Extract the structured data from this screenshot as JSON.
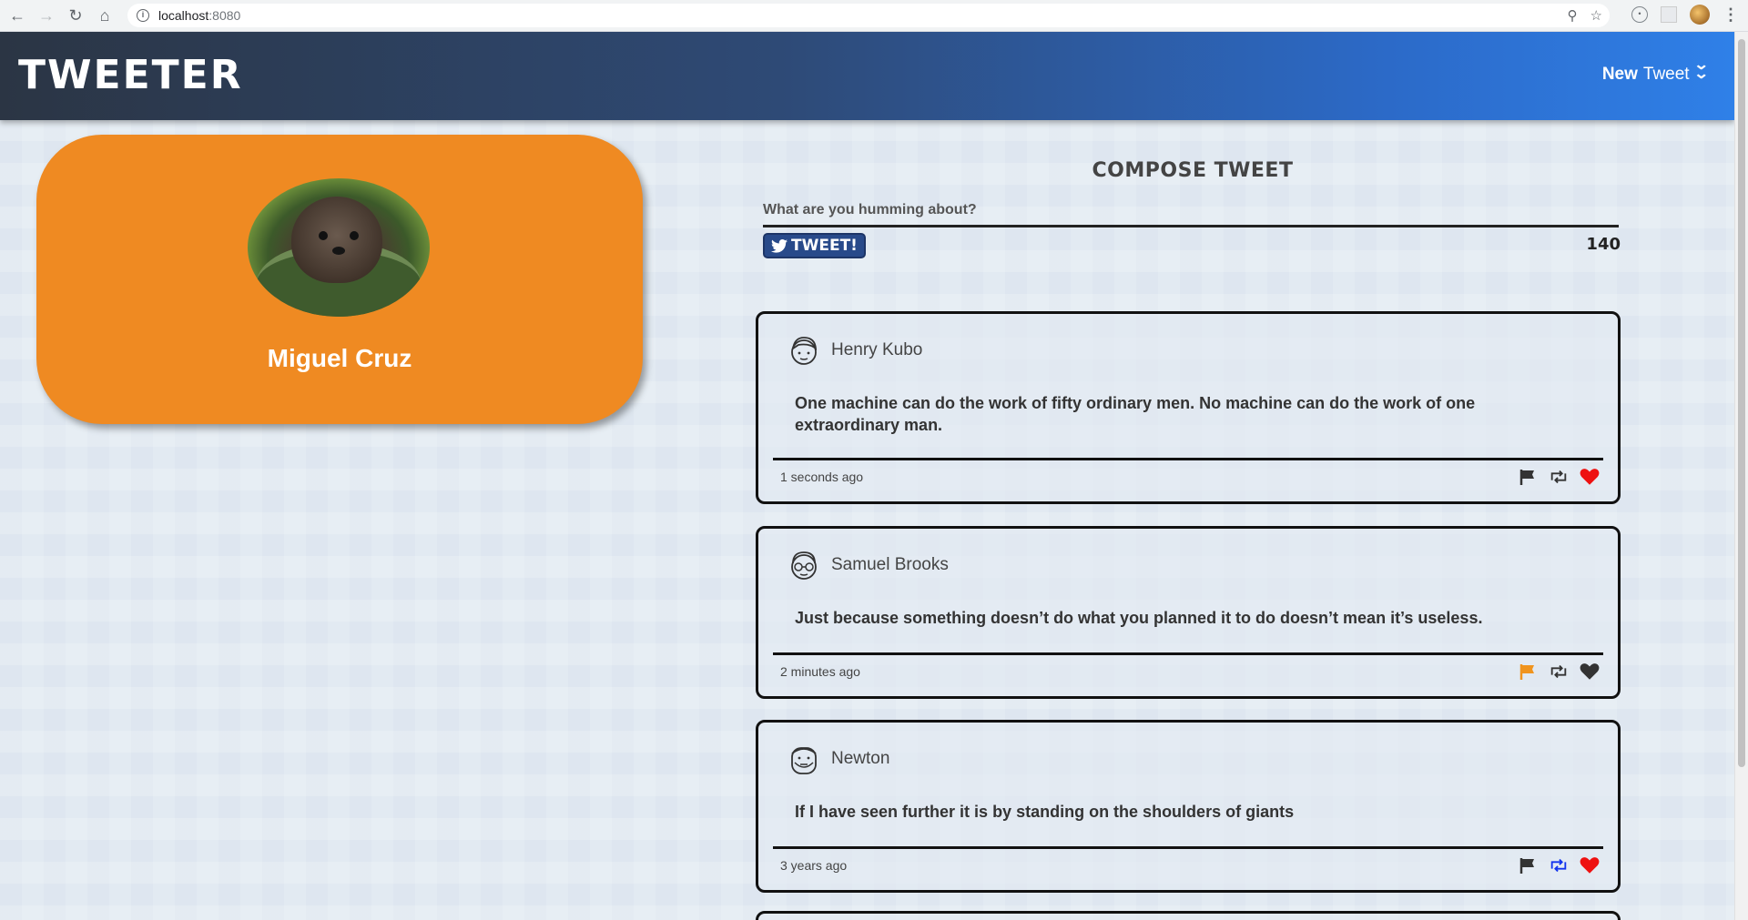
{
  "browser": {
    "url_host": "localhost",
    "url_port": ":8080"
  },
  "header": {
    "logo": "TWEETER",
    "new_tweet_bold": "New",
    "new_tweet_rest": "Tweet"
  },
  "profile": {
    "name": "Miguel Cruz"
  },
  "compose": {
    "title": "COMPOSE TWEET",
    "placeholder": "What are you humming about?",
    "button_label": "TWEET!",
    "counter": "140"
  },
  "tweets": [
    {
      "author": "Henry Kubo",
      "text": "One machine can do the work of fifty ordinary men. No machine can do the work of one extraordinary man.",
      "time": "1 seconds ago",
      "flag_color": "#333333",
      "retweet_color": "#333333",
      "like_color": "#ee1111"
    },
    {
      "author": "Samuel Brooks",
      "text": "Just because something doesn’t do what you planned it to do doesn’t mean it’s useless.",
      "time": "2 minutes ago",
      "flag_color": "#f0941e",
      "retweet_color": "#333333",
      "like_color": "#333333"
    },
    {
      "author": "Newton",
      "text": "If I have seen further it is by standing on the shoulders of giants",
      "time": "3 years ago",
      "flag_color": "#333333",
      "retweet_color": "#1133ee",
      "like_color": "#ee1111"
    }
  ]
}
